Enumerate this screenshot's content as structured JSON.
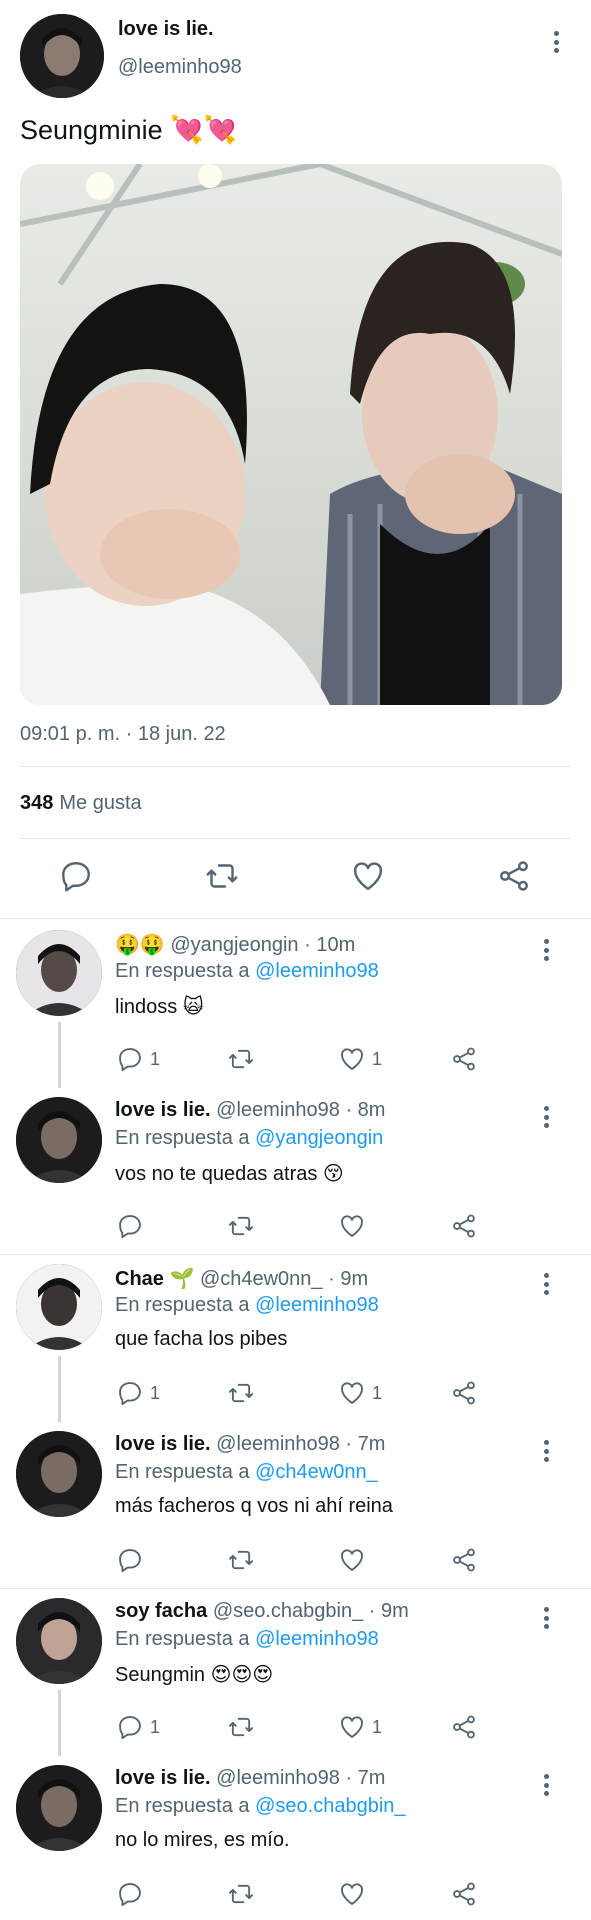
{
  "main_tweet": {
    "author_name": "love is lie.",
    "author_handle": "@leeminho98",
    "text": "Seungminie 💘💘",
    "timestamp": "09:01 p. m. · 18 jun. 22",
    "likes_count": "348",
    "likes_label": "Me gusta",
    "actions": [
      "reply-icon",
      "retweet-icon",
      "like-icon",
      "share-icon"
    ]
  },
  "replies": [
    {
      "name_emoji": "🤑🤑",
      "name": "",
      "handle": "@yangjeongin",
      "time": "10m",
      "reply_prefix": "En respuesta a",
      "reply_to": "@leeminho98",
      "text": "lindoss 🙀",
      "reply_count": "1",
      "like_count": "1"
    },
    {
      "name_emoji": "",
      "name": "love is lie.",
      "handle": "@leeminho98",
      "time": "8m",
      "reply_prefix": "En respuesta a",
      "reply_to": "@yangjeongin",
      "text": "vos no te quedas atras 😚",
      "reply_count": "",
      "like_count": ""
    },
    {
      "name_emoji": "",
      "name": "Chae 🌱",
      "handle": "@ch4ew0nn_",
      "time": "9m",
      "reply_prefix": "En respuesta a",
      "reply_to": "@leeminho98",
      "text": "que facha los pibes",
      "reply_count": "1",
      "like_count": "1"
    },
    {
      "name_emoji": "",
      "name": "love is lie.",
      "handle": "@leeminho98",
      "time": "7m",
      "reply_prefix": "En respuesta a",
      "reply_to": "@ch4ew0nn_",
      "text": "más facheros q vos ni ahí reina",
      "reply_count": "",
      "like_count": ""
    },
    {
      "name_emoji": "",
      "name": "soy facha",
      "handle": "@seo.chabgbin_",
      "time": "9m",
      "reply_prefix": "En respuesta a",
      "reply_to": "@leeminho98",
      "text": "Seungmin 😍😍😍",
      "reply_count": "1",
      "like_count": "1"
    },
    {
      "name_emoji": "",
      "name": "love is lie.",
      "handle": "@leeminho98",
      "time": "7m",
      "reply_prefix": "En respuesta a",
      "reply_to": "@seo.chabgbin_",
      "text": "no lo mires, es mío.",
      "reply_count": "",
      "like_count": ""
    }
  ],
  "colors": {
    "text": "#0f1419",
    "secondary": "#536471",
    "link": "#1d9bf0",
    "divider": "#e3e6e8"
  }
}
